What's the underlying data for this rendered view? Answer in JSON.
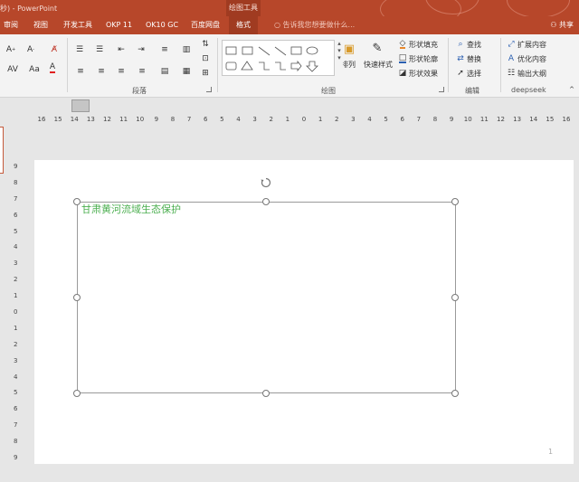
{
  "titlebar": {
    "app_title": "秒)  -  PowerPoint",
    "context_title": "绘图工具"
  },
  "tabs": [
    "审阅",
    "视图",
    "开发工具",
    "OKP 11",
    "OK10 GC",
    "百度网盘",
    "格式"
  ],
  "active_tab": "格式",
  "tell_me": "告诉我您想要做什么...",
  "share": "共享",
  "ribbon": {
    "groups": {
      "paragraph": "段落",
      "drawing": "绘图",
      "editing": "编辑",
      "deepseek": "deepseek"
    },
    "arrange_label": "排列",
    "quick_styles_label": "快速样式",
    "shape_fill": "形状填充",
    "shape_outline": "形状轮廓",
    "shape_effects": "形状效果",
    "find": "查找",
    "replace": "替换",
    "select": "选择",
    "expand_content": "扩展内容",
    "optimize_content": "优化内容",
    "output_outline": "输出大纲"
  },
  "hruler_labels": [
    "16",
    "15",
    "14",
    "13",
    "12",
    "11",
    "10",
    "9",
    "8",
    "7",
    "6",
    "5",
    "4",
    "3",
    "2",
    "1",
    "0",
    "1",
    "2",
    "3",
    "4",
    "5",
    "6",
    "7",
    "8",
    "9",
    "10",
    "11",
    "12",
    "13",
    "14",
    "15",
    "16"
  ],
  "vruler_labels": [
    "9",
    "8",
    "7",
    "6",
    "5",
    "4",
    "3",
    "2",
    "1",
    "0",
    "1",
    "2",
    "3",
    "4",
    "5",
    "6",
    "7",
    "8",
    "9"
  ],
  "slide": {
    "textbox_text": "甘肃黄河流域生态保护",
    "page_number": "1"
  },
  "colors": {
    "accent": "#b7472a",
    "text_green": "#4caf50",
    "font_color_red": "#e02020",
    "fill_orange": "#e8882c",
    "outline_blue": "#2b5fb0"
  }
}
